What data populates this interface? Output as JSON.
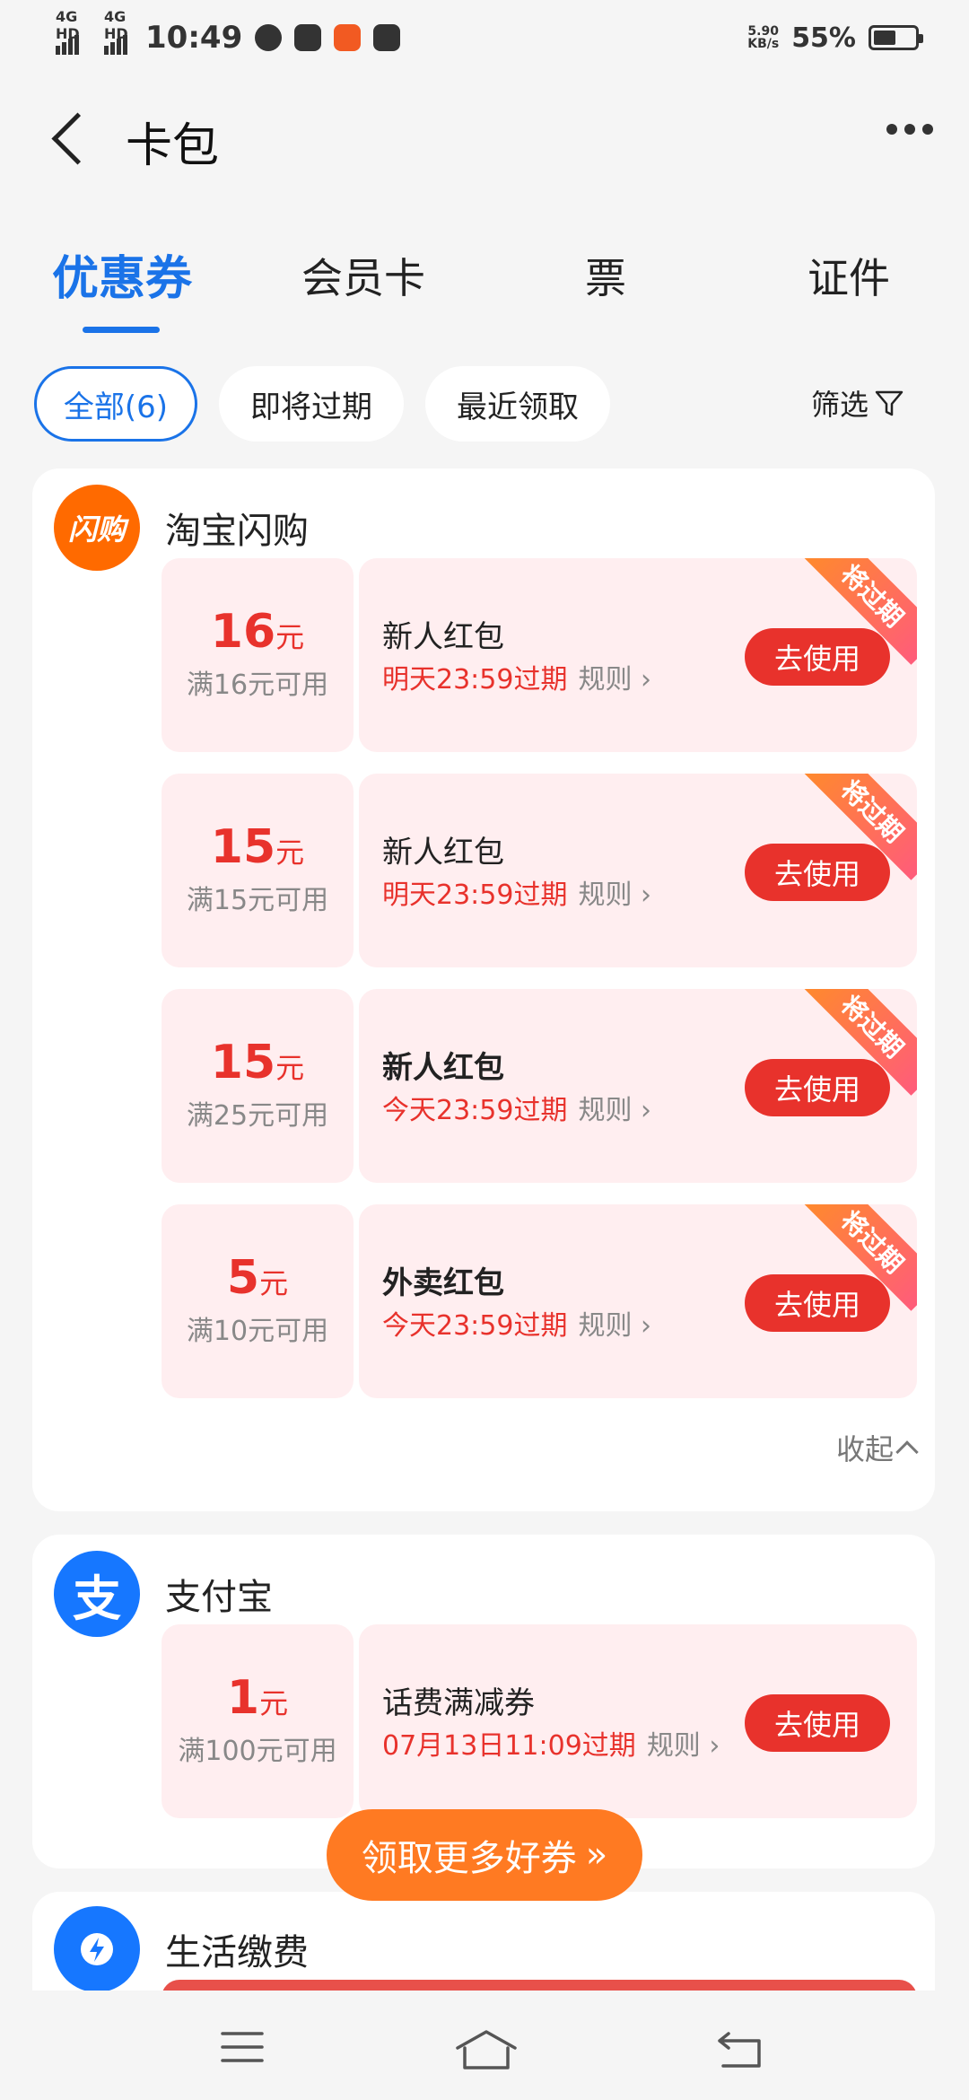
{
  "status_bar": {
    "signal1": "4G HD",
    "signal2": "4G HD",
    "time": "10:49",
    "speed_top": "5.90",
    "speed_bottom": "KB/s",
    "battery": "55%"
  },
  "header": {
    "title": "卡包"
  },
  "tabs": [
    {
      "label": "优惠券"
    },
    {
      "label": "会员卡"
    },
    {
      "label": "票"
    },
    {
      "label": "证件"
    }
  ],
  "filters": {
    "chips": [
      "全部(6)",
      "即将过期",
      "最近领取"
    ],
    "filter_label": "筛选"
  },
  "groups": [
    {
      "merchant": "淘宝闪购",
      "logo_text": "闪购",
      "logo_color": "#ff6a00",
      "coupons": [
        {
          "amount": "16",
          "unit": "元",
          "condition": "满16元可用",
          "name": "新人红包",
          "expiry": "明天23:59过期",
          "rule": "规则",
          "button": "去使用",
          "ribbon": "将过期"
        },
        {
          "amount": "15",
          "unit": "元",
          "condition": "满15元可用",
          "name": "新人红包",
          "expiry": "明天23:59过期",
          "rule": "规则",
          "button": "去使用",
          "ribbon": "将过期"
        },
        {
          "amount": "15",
          "unit": "元",
          "condition": "满25元可用",
          "name": "新人红包",
          "expiry": "今天23:59过期",
          "rule": "规则",
          "button": "去使用",
          "ribbon": "将过期"
        },
        {
          "amount": "5",
          "unit": "元",
          "condition": "满10元可用",
          "name": "外卖红包",
          "expiry": "今天23:59过期",
          "rule": "规则",
          "button": "去使用",
          "ribbon": "将过期"
        }
      ],
      "collapse_label": "收起"
    },
    {
      "merchant": "支付宝",
      "logo_text": "支",
      "logo_color": "#1677ff",
      "coupons": [
        {
          "amount": "1",
          "unit": "元",
          "condition": "满100元可用",
          "name": "话费满减券",
          "expiry": "07月13日11:09过期",
          "rule": "规则",
          "button": "去使用"
        }
      ]
    },
    {
      "merchant": "生活缴费",
      "logo_color": "#1677ff"
    }
  ],
  "cta": {
    "label": "领取更多好券",
    "icon": "double-chevron-right"
  },
  "nav": {
    "menu": "menu-icon",
    "home": "home-icon",
    "back": "back-icon"
  }
}
